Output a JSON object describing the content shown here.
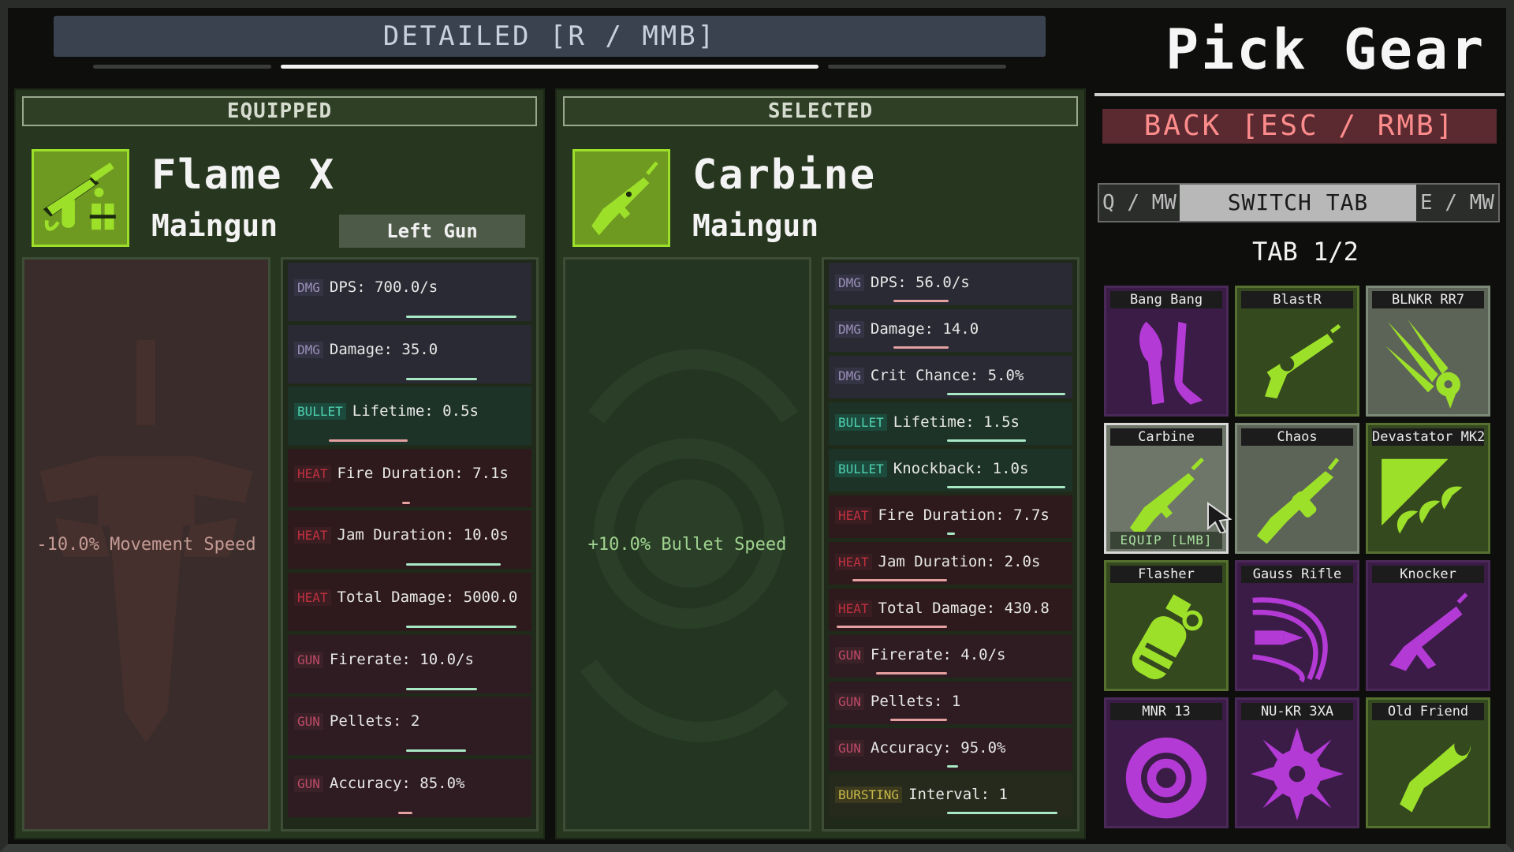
{
  "topbar": {
    "label": "DETAILED [R / MMB]"
  },
  "equipped": {
    "header": "EQUIPPED",
    "name": "Flame X",
    "type": "Maingun",
    "slot": "Left Gun",
    "icon": "flamethrower-icon",
    "perk": "-10.0% Movement Speed",
    "stats": [
      {
        "tag": "DMG",
        "text": "DPS: 700.0/s",
        "kind": "dmg"
      },
      {
        "tag": "DMG",
        "text": "Damage: 35.0",
        "kind": "dmg"
      },
      {
        "tag": "BULLET",
        "text": "Lifetime: 0.5s",
        "kind": "bullet"
      },
      {
        "tag": "HEAT",
        "text": "Fire Duration: 7.1s",
        "kind": "heat"
      },
      {
        "tag": "HEAT",
        "text": "Jam Duration: 10.0s",
        "kind": "heat"
      },
      {
        "tag": "HEAT",
        "text": "Total Damage: 5000.0",
        "kind": "heat"
      },
      {
        "tag": "GUN",
        "text": "Firerate: 10.0/s",
        "kind": "gun"
      },
      {
        "tag": "GUN",
        "text": "Pellets: 2",
        "kind": "gun"
      },
      {
        "tag": "GUN",
        "text": "Accuracy: 85.0%",
        "kind": "gun"
      }
    ]
  },
  "selected": {
    "header": "SELECTED",
    "name": "Carbine",
    "type": "Maingun",
    "icon": "carbine-rifle-icon",
    "perk": "+10.0% Bullet Speed",
    "stats": [
      {
        "tag": "DMG",
        "text": "DPS: 56.0/s",
        "kind": "dmg"
      },
      {
        "tag": "DMG",
        "text": "Damage: 14.0",
        "kind": "dmg"
      },
      {
        "tag": "DMG",
        "text": "Crit Chance: 5.0%",
        "kind": "dmg"
      },
      {
        "tag": "BULLET",
        "text": "Lifetime: 1.5s",
        "kind": "bullet"
      },
      {
        "tag": "BULLET",
        "text": "Knockback: 1.0s",
        "kind": "bullet"
      },
      {
        "tag": "HEAT",
        "text": "Fire Duration: 7.7s",
        "kind": "heat"
      },
      {
        "tag": "HEAT",
        "text": "Jam Duration: 2.0s",
        "kind": "heat"
      },
      {
        "tag": "HEAT",
        "text": "Total Damage: 430.8",
        "kind": "heat"
      },
      {
        "tag": "GUN",
        "text": "Firerate: 4.0/s",
        "kind": "gun"
      },
      {
        "tag": "GUN",
        "text": "Pellets: 1",
        "kind": "gun"
      },
      {
        "tag": "GUN",
        "text": "Accuracy: 95.0%",
        "kind": "gun"
      },
      {
        "tag": "BURSTING",
        "text": "Interval: 1",
        "kind": "burst"
      }
    ]
  },
  "sidebar": {
    "title": "Pick Gear",
    "back": "BACK [ESC / RMB]",
    "tab_prev": "Q / MW",
    "tab_switch": "SWITCH TAB",
    "tab_next": "E / MW",
    "tab_indicator": "TAB 1/2",
    "equip_hint": "EQUIP [LMB]",
    "items": [
      {
        "name": "Bang Bang",
        "style": "purple",
        "icon": "dual-blade-icon"
      },
      {
        "name": "BlastR",
        "style": "green",
        "icon": "revolver-icon"
      },
      {
        "name": "BLNKR RR7",
        "style": "gray",
        "icon": "claw-blaster-icon"
      },
      {
        "name": "Carbine",
        "style": "selected",
        "icon": "carbine-rifle-icon"
      },
      {
        "name": "Chaos",
        "style": "gray",
        "icon": "tommy-gun-icon"
      },
      {
        "name": "Devastator MK2",
        "style": "green",
        "icon": "fang-cannon-icon"
      },
      {
        "name": "Flasher",
        "style": "green",
        "icon": "flash-grenade-icon"
      },
      {
        "name": "Gauss Rifle",
        "style": "purple",
        "icon": "gauss-rifle-icon"
      },
      {
        "name": "Knocker",
        "style": "purple",
        "icon": "assault-rifle-icon"
      },
      {
        "name": "MNR 13",
        "style": "purple",
        "icon": "gear-mine-icon"
      },
      {
        "name": "NU-KR 3XA",
        "style": "purple",
        "icon": "spiked-ball-icon"
      },
      {
        "name": "Old Friend",
        "style": "green",
        "icon": "blunderbuss-icon"
      }
    ]
  }
}
